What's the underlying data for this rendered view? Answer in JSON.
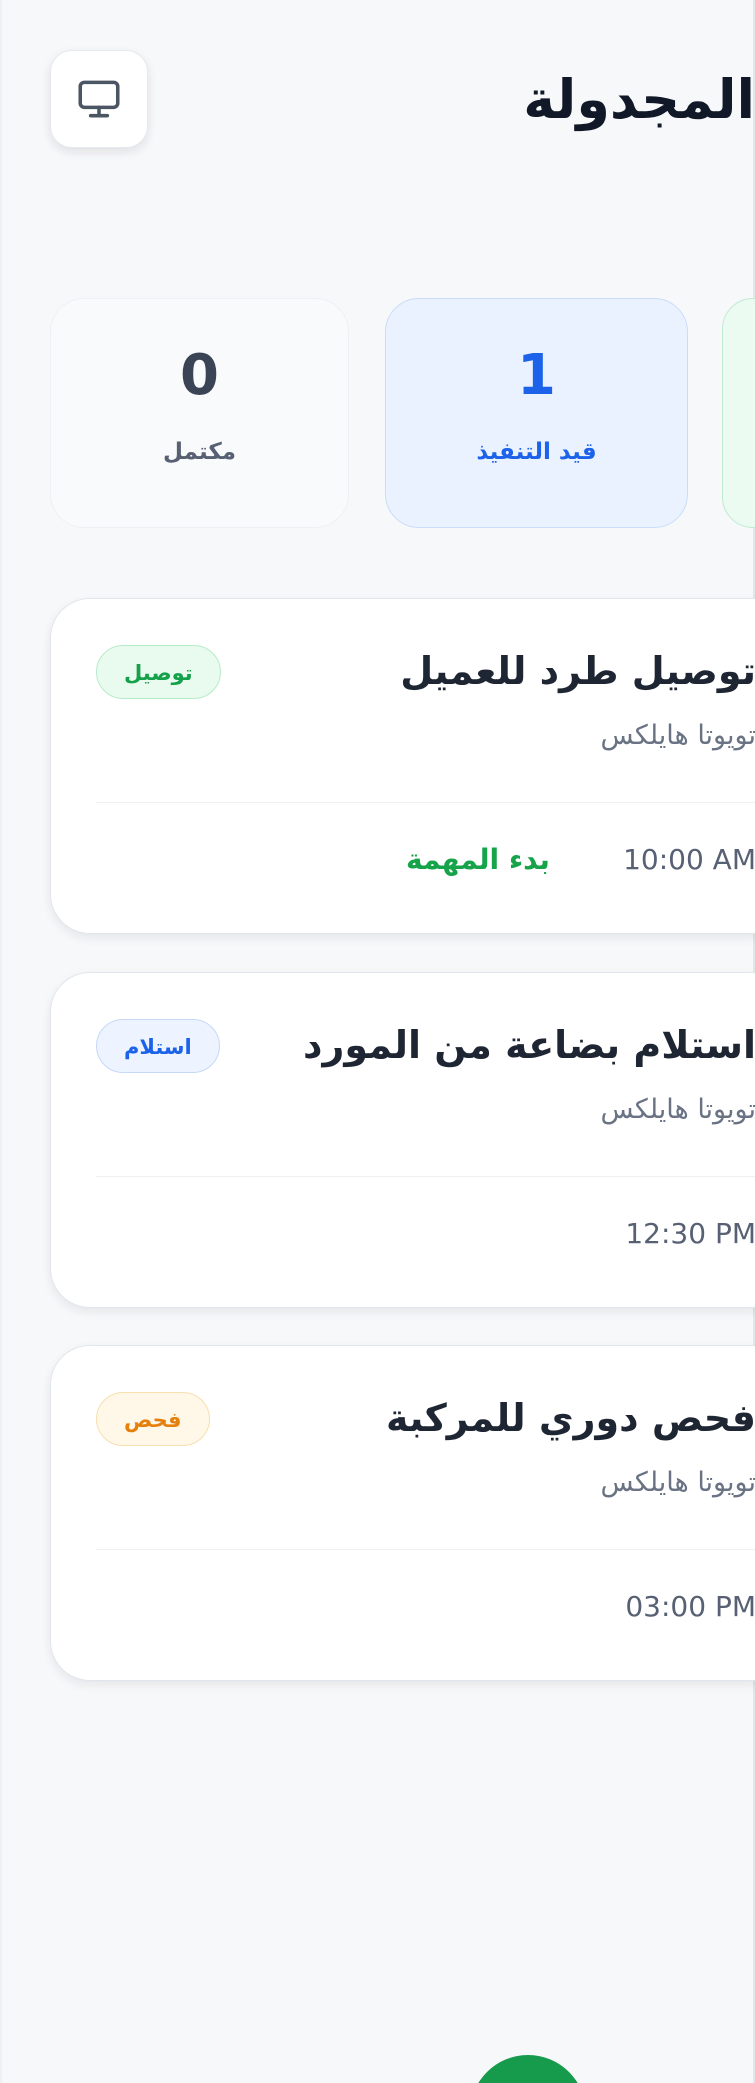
{
  "header": {
    "title": "المجدولة",
    "monitor_icon": "monitor-icon"
  },
  "stats": {
    "completed": {
      "value": "0",
      "label": "مكتمل"
    },
    "in_progress": {
      "value": "1",
      "label": "قيد التنفيذ"
    }
  },
  "tasks": [
    {
      "title": "توصيل طرد للعميل",
      "vehicle": "تويوتا هايلكس",
      "time": "10:00 AM",
      "action": "بدء المهمة",
      "badge": "توصيل"
    },
    {
      "title": "استلام بضاعة من المورد",
      "vehicle": "تويوتا هايلكس",
      "time": "12:30 PM",
      "badge": "استلام"
    },
    {
      "title": "فحص دوري للمركبة",
      "vehicle": "تويوتا هايلكس",
      "time": "03:00 PM",
      "badge": "فحص"
    }
  ],
  "colors": {
    "background": "#f7f8fa",
    "primary_blue": "#1d63ea",
    "success_green": "#16a34a",
    "warning_orange": "#e6800d",
    "fab_green": "#169a4b"
  }
}
